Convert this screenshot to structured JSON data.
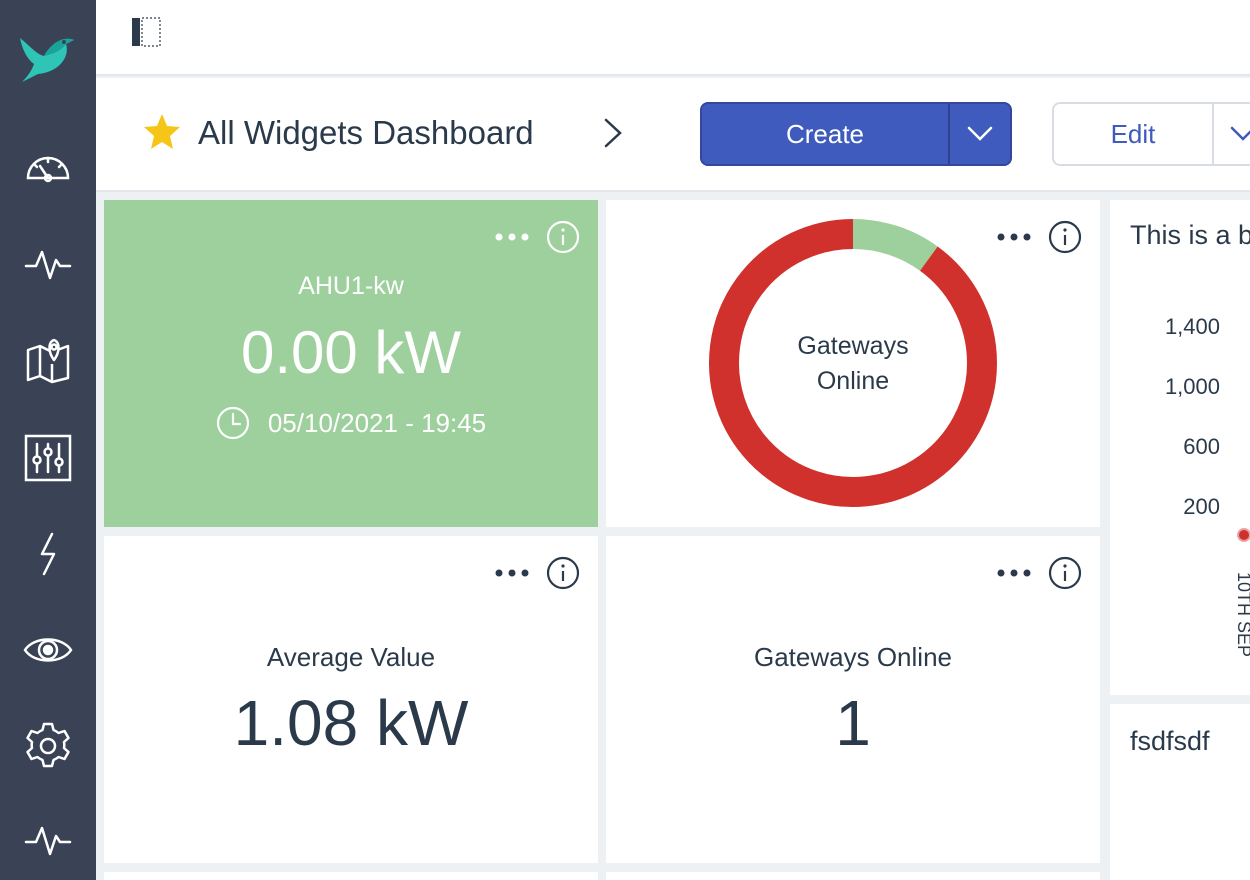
{
  "sidebar": {
    "items": [
      {
        "name": "dashboard-gauge-icon"
      },
      {
        "name": "activity-icon"
      },
      {
        "name": "map-icon"
      },
      {
        "name": "sliders-icon"
      },
      {
        "name": "lightning-icon"
      },
      {
        "name": "eye-icon"
      },
      {
        "name": "gear-icon"
      },
      {
        "name": "activity-icon"
      }
    ]
  },
  "header": {
    "title": "All Widgets Dashboard",
    "create_label": "Create",
    "edit_label": "Edit"
  },
  "widgets": {
    "ahu": {
      "label": "AHU1-kw",
      "value": "0.00 kW",
      "timestamp": "05/10/2021 - 19:45",
      "color": "#9ed09d"
    },
    "donut": {
      "center_line1": "Gateways",
      "center_line2": "Online",
      "slices": [
        {
          "value": 1,
          "color": "#9ed09d"
        },
        {
          "value": 9,
          "color": "#d0312d"
        }
      ]
    },
    "average": {
      "label": "Average Value",
      "value": "1.08 kW"
    },
    "gateways": {
      "label": "Gateways Online",
      "value": "1"
    },
    "chart": {
      "title": "This is a b",
      "y_ticks": [
        "1,400",
        "1,000",
        "600",
        "200"
      ],
      "x_tick": "10TH SEP"
    },
    "text": {
      "content": "fsdfsdf"
    }
  },
  "colors": {
    "sidebar": "#3a4356",
    "primary": "#3f5bbd",
    "red": "#d0312d",
    "green": "#9ed09d"
  }
}
